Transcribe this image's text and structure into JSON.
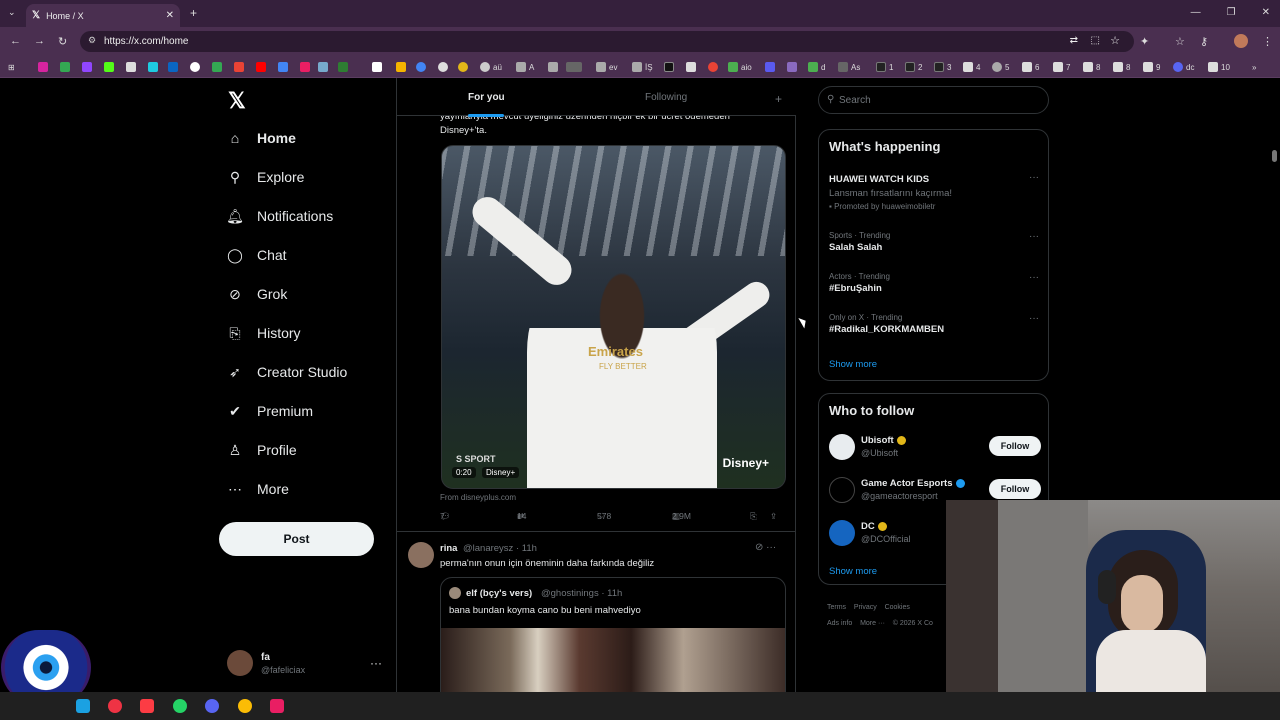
{
  "browser": {
    "tab_title": "Home / X",
    "url": "https://x.com/home",
    "bookmarks": [
      "aü",
      "A",
      "ev",
      "İŞ",
      "aio",
      "d",
      "As",
      "1",
      "2",
      "3",
      "4",
      "5",
      "6",
      "7",
      "8",
      "8",
      "9",
      "dc",
      "10"
    ]
  },
  "nav": {
    "items": [
      {
        "label": "Home",
        "icon": "home-icon"
      },
      {
        "label": "Explore",
        "icon": "search-icon"
      },
      {
        "label": "Notifications",
        "icon": "bell-icon"
      },
      {
        "label": "Chat",
        "icon": "chat-icon"
      },
      {
        "label": "Grok",
        "icon": "grok-icon"
      },
      {
        "label": "History",
        "icon": "bookmark-icon"
      },
      {
        "label": "Creator Studio",
        "icon": "rocket-icon"
      },
      {
        "label": "Premium",
        "icon": "verified-icon"
      },
      {
        "label": "Profile",
        "icon": "person-icon"
      },
      {
        "label": "More",
        "icon": "more-circle-icon"
      }
    ],
    "post_label": "Post",
    "account": {
      "name": "fa",
      "handle": "@fafeliciax"
    }
  },
  "feed": {
    "tab_for_you": "For you",
    "tab_following": "Following",
    "tweet1": {
      "text_top": "yayınlarıyla mevcut üyeliğiniz üzerinden hiçbir ek bir ücret ödemeden",
      "text_bottom": "Disney+'ta.",
      "media_duration": "0:20",
      "media_tag": "Disney+",
      "sponsor": "Emirates",
      "sponsor_sub": "FLY BETTER",
      "watermark": "S SPORT",
      "brand": "Disney+",
      "from": "From disneyplus.com",
      "replies": "7",
      "reposts": "14",
      "likes": "578",
      "views": "2.9M"
    },
    "tweet2": {
      "name": "rina",
      "meta": "@lanareysz · 11h",
      "text": "perma'nın onun için öneminin daha farkında değiliz",
      "quote": {
        "name": "elf (bçy's vers)",
        "meta": "@ghostinings · 11h",
        "text": "bana bundan koyma cano bu beni mahvediyo"
      }
    }
  },
  "sidebar": {
    "search_placeholder": "Search",
    "whats_happening": "What's happening",
    "trends": [
      {
        "category": "HUAWEI WATCH KIDS",
        "title": "Lansman fırsatlarını kaçırma!",
        "promo": "Promoted by huaweimobiletr"
      },
      {
        "category": "Sports · Trending",
        "title": "Salah Salah"
      },
      {
        "category": "Actors · Trending",
        "title": "#EbruŞahin"
      },
      {
        "category": "Only on X · Trending",
        "title": "#Radikal_KORKMAMBEN"
      }
    ],
    "show_more": "Show more",
    "who_to_follow": "Who to follow",
    "follow_label": "Follow",
    "suggestions": [
      {
        "name": "Ubisoft",
        "handle": "@Ubisoft",
        "badge_color": "#e2b719"
      },
      {
        "name": "Game Actor Esports",
        "handle": "@gameactoresport",
        "badge_color": "#1d9bf0"
      },
      {
        "name": "DC",
        "handle": "@DCOfficial",
        "badge_color": "#e2b719"
      }
    ],
    "footer_line1": [
      "Terms",
      "Privacy",
      "Cookies"
    ],
    "footer_line2": [
      "Ads info",
      "More ···",
      "© 2026 X Co"
    ]
  }
}
